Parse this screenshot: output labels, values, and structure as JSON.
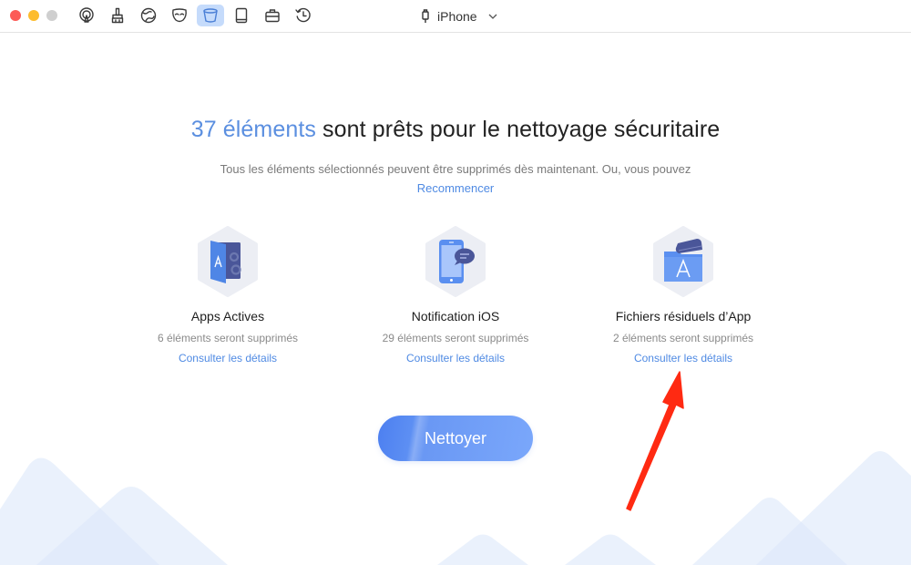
{
  "window": {
    "traffic_lights": [
      "close",
      "minimize",
      "maximize"
    ]
  },
  "toolbar": {
    "tools": [
      {
        "name": "airplay-icon",
        "active": false
      },
      {
        "name": "broom-icon",
        "active": false
      },
      {
        "name": "globe-icon",
        "active": false
      },
      {
        "name": "mask-icon",
        "active": false
      },
      {
        "name": "bucket-icon",
        "active": true
      },
      {
        "name": "tablet-icon",
        "active": false
      },
      {
        "name": "toolbox-icon",
        "active": false
      },
      {
        "name": "history-icon",
        "active": false
      }
    ],
    "device": {
      "label": "iPhone",
      "icon": "lightning-cable-icon"
    }
  },
  "main": {
    "headline_count": "37 éléments",
    "headline_rest": " sont prêts pour le nettoyage sécuritaire",
    "subtitle": "Tous les éléments sélectionnés peuvent être supprimés dès maintenant. Ou, vous pouvez",
    "restart_link": "Recommencer",
    "cards": [
      {
        "icon": "active-apps-icon",
        "title": "Apps Actives",
        "count": "6 éléments seront supprimés",
        "link": "Consulter les détails"
      },
      {
        "icon": "ios-notification-icon",
        "title": "Notification iOS",
        "count": "29 éléments seront supprimés",
        "link": "Consulter les détails"
      },
      {
        "icon": "app-residual-files-icon",
        "title": "Fichiers résiduels d’App",
        "count": "2 éléments seront supprimés",
        "link": "Consulter les détails"
      }
    ],
    "clean_button": "Nettoyer"
  },
  "colors": {
    "accent": "#5b8fe0",
    "link": "#4f8ae3",
    "active_tool_bg": "#c5dbfb",
    "annotation_arrow": "#ff2a12"
  }
}
